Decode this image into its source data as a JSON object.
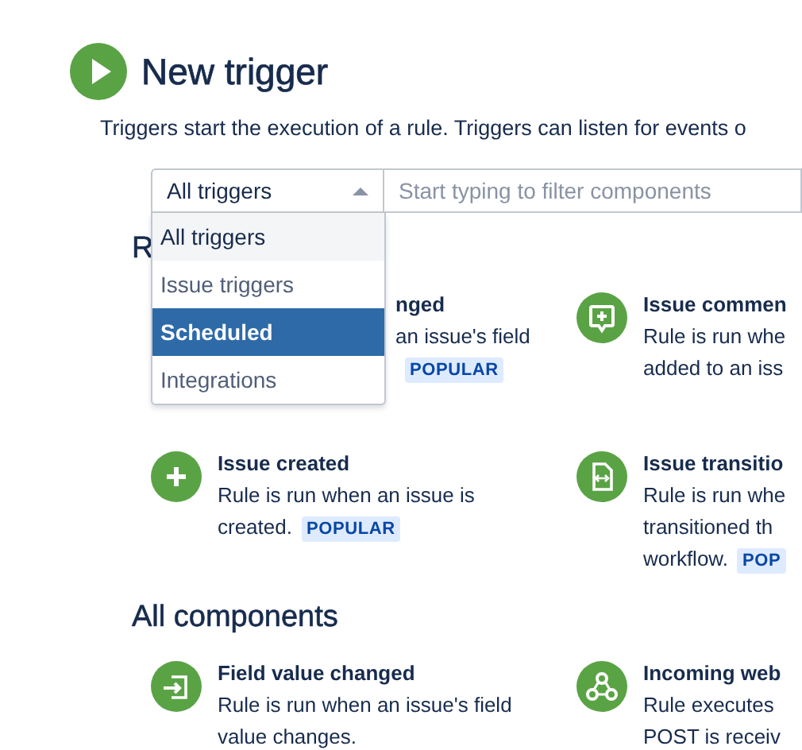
{
  "header": {
    "title": "New trigger",
    "description": "Triggers start the execution of a rule. Triggers can listen for events o"
  },
  "filter": {
    "select_value": "All triggers",
    "expanded": true,
    "placeholder": "Start typing to filter components"
  },
  "dropdown": {
    "options": [
      {
        "label": "All triggers",
        "selected": false,
        "current": true
      },
      {
        "label": "Issue triggers",
        "selected": false,
        "current": false
      },
      {
        "label": "Scheduled",
        "selected": true,
        "current": false
      },
      {
        "label": "Integrations",
        "selected": false,
        "current": false
      }
    ]
  },
  "sections": [
    {
      "heading": "R",
      "rows": [
        [
          {
            "title": "nged",
            "lines": [
              "an issue's field"
            ],
            "badge": "POPULAR"
          },
          {
            "kind": "comment-plus",
            "title": "Issue commen",
            "lines": [
              "Rule is run whe",
              "added to an iss"
            ]
          }
        ],
        [
          {
            "kind": "plus",
            "title": "Issue created",
            "lines": [
              "Rule is run when an issue is",
              "created."
            ],
            "badge": "POPULAR"
          },
          {
            "kind": "document",
            "title": "Issue transitio",
            "lines": [
              "Rule is run whe",
              "transitioned th",
              "workflow."
            ],
            "badge": "POP"
          }
        ]
      ]
    },
    {
      "heading": "All components",
      "rows": [
        [
          {
            "kind": "field-arrow",
            "title": "Field value changed",
            "lines": [
              "Rule is run when an issue's field",
              "value changes."
            ]
          },
          {
            "kind": "webhook",
            "title": "Incoming web",
            "lines": [
              "Rule executes",
              "POST is receiv"
            ]
          }
        ]
      ]
    }
  ]
}
